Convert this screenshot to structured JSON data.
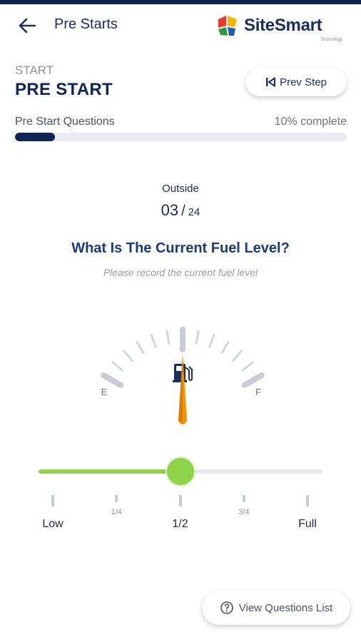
{
  "header": {
    "title": "Pre Starts",
    "brand": "SiteSmart",
    "brand_sub": "Technology",
    "back_icon": "arrow-left-icon"
  },
  "step": {
    "label": "START",
    "title": "PRE START",
    "prev_button": "Prev Step"
  },
  "progress": {
    "label": "Pre Start Questions",
    "status": "10% complete",
    "fraction": 0.12
  },
  "question": {
    "section": "Outside",
    "current": "03",
    "separator": "/",
    "total": "24",
    "title": "What Is The Current Fuel Level?",
    "hint": "Please record the current fuel level"
  },
  "gauge": {
    "empty_label": "E",
    "full_label": "F",
    "value": 0.5
  },
  "slider": {
    "value": 0.5,
    "labels": [
      "Low",
      "1/4",
      "1/2",
      "3/4",
      "Full"
    ]
  },
  "footer": {
    "view_questions": "View Questions List"
  },
  "colors": {
    "navy": "#0f2557",
    "accent_green": "#8fd34a",
    "needle_orange": "#f39200"
  }
}
